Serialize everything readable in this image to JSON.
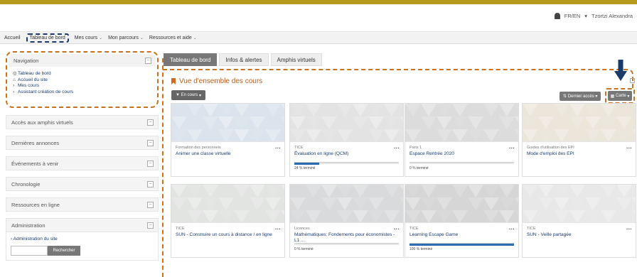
{
  "user": {
    "lang": "FR/EN",
    "name": "Tzortzi Alexandra"
  },
  "navbar": {
    "items": [
      {
        "label": "Accueil",
        "dropdown": false
      },
      {
        "label": "Tableau de bord",
        "dropdown": false
      },
      {
        "label": "Mes cours",
        "dropdown": true
      },
      {
        "label": "Mon parcours",
        "dropdown": true
      },
      {
        "label": "Ressources et aide",
        "dropdown": true
      }
    ]
  },
  "sidebar": {
    "navigation": {
      "title": "Navigation",
      "items": [
        "Tableau de bord",
        "Accueil du site",
        "Mes cours",
        "Assistant création de cours"
      ]
    },
    "blocks": [
      "Accès aux amphis virtuels",
      "Dernières annonces",
      "Événements à venir",
      "Chronologie",
      "Ressources en ligne"
    ],
    "admin": {
      "title": "Administration",
      "link": "Administration du site",
      "search_button": "Rechercher"
    }
  },
  "tabs": [
    "Tableau de bord",
    "Infos & alertes",
    "Amphis virtuels"
  ],
  "overview": {
    "title": "Vue d'ensemble des cours",
    "filter": "En cours",
    "sort": "Dernier accès",
    "view": "Carte"
  },
  "courses": [
    {
      "category": "Formation des personnels",
      "name": "Animer une classe virtuelle",
      "progress": null,
      "progress_text": "",
      "color": "#dbe4ec"
    },
    {
      "category": "TICE",
      "name": "Évaluation en ligne (QCM)",
      "progress": 24,
      "progress_text": "24 % terminé",
      "color": "#e3e3e3"
    },
    {
      "category": "Paris 1",
      "name": "Espace Rentrée 2020",
      "progress": 0,
      "progress_text": "0 % terminé",
      "color": "#dcdcdc"
    },
    {
      "category": "Guides d'utilisation des EPI",
      "name": "Mode d'emploi des EPI",
      "progress": null,
      "progress_text": "",
      "color": "#ebe5da"
    },
    {
      "category": "TICE",
      "name": "SUN - Construire un cours à distance / en ligne",
      "progress": null,
      "progress_text": "",
      "color": "#e2e4e2"
    },
    {
      "category": "Licences",
      "name": "Mathématiques: Fondements pour économistes - L1 ...",
      "progress": 0,
      "progress_text": "0 % terminé",
      "color": "#d9dadb"
    },
    {
      "category": "TICE",
      "name": "Learning Escape Game",
      "progress": 100,
      "progress_text": "100 % terminé",
      "color": "#d6d6d6"
    },
    {
      "category": "TICE",
      "name": "SUN - Veille partagée",
      "progress": null,
      "progress_text": "",
      "color": "#e8e8e8"
    }
  ],
  "colors": {
    "accent": "#c8721f",
    "link": "#1a3a6b",
    "progress": "#2d6cae",
    "topbar": "#b8991f"
  }
}
